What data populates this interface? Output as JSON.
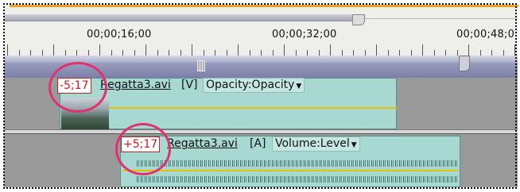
{
  "ruler": {
    "timecodes": [
      "00;00;16;00",
      "00;00;32;00",
      "00;00;48;0"
    ]
  },
  "video_clip": {
    "offset": "-5;17",
    "name": "Regatta3.avi",
    "track_tag": "[V]",
    "property": "Opacity:Opacity",
    "menu_arrow": "▼"
  },
  "audio_clip": {
    "offset": "+5;17",
    "name": "Regatta3.avi",
    "track_tag": "[A]",
    "property": "Volume:Level",
    "menu_arrow": "▼"
  },
  "colors": {
    "clip_fill": "#a8d8d2",
    "highlight_circle": "#e0326e",
    "offset_text": "#d21818",
    "keyframe_line": "#e8c000",
    "work_area_bar": "#7c80a8"
  }
}
